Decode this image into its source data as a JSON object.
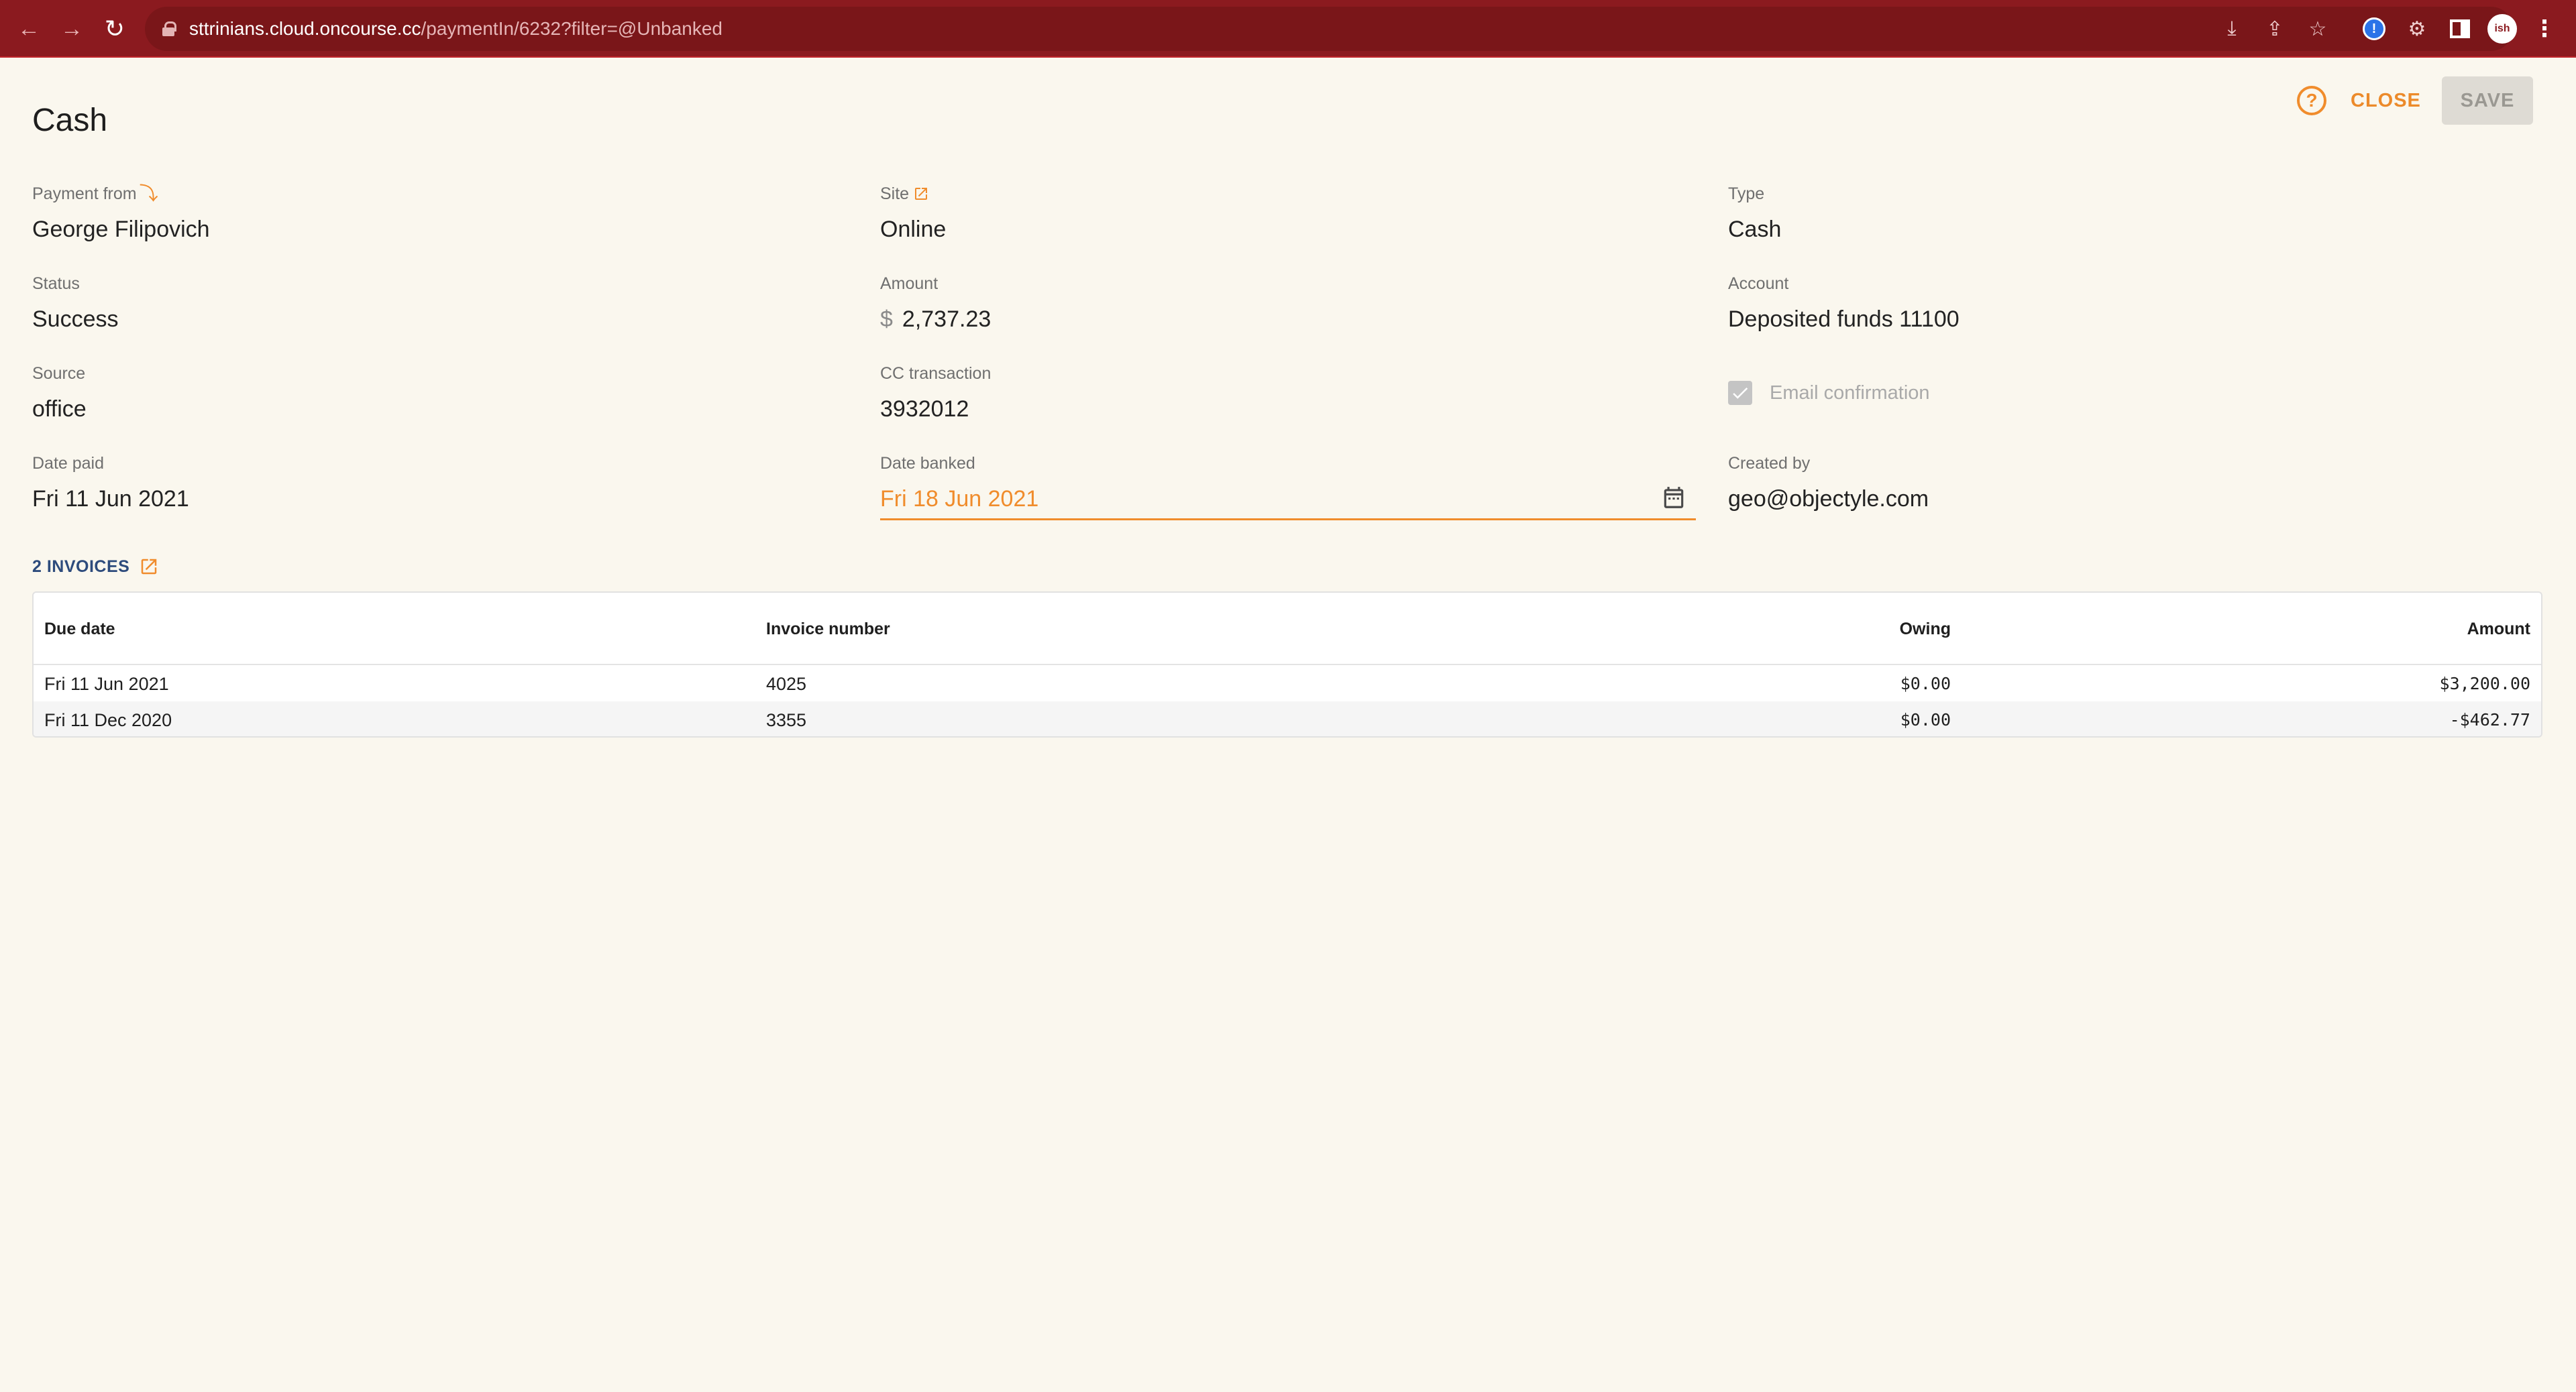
{
  "browser": {
    "url_host": "sttrinians.cloud.oncourse.cc",
    "url_path": "/paymentIn/6232?filter=@Unbanked",
    "avatar_text": "ish"
  },
  "header": {
    "title": "Cash",
    "close_label": "CLOSE",
    "save_label": "SAVE"
  },
  "fields": {
    "payment_from": {
      "label": "Payment from",
      "value": "George Filipovich"
    },
    "status": {
      "label": "Status",
      "value": "Success"
    },
    "source": {
      "label": "Source",
      "value": "office"
    },
    "date_paid": {
      "label": "Date paid",
      "value": "Fri 11 Jun 2021"
    },
    "site": {
      "label": "Site",
      "value": "Online"
    },
    "amount": {
      "label": "Amount",
      "currency": "$",
      "value": "2,737.23"
    },
    "cc_transaction": {
      "label": "CC transaction",
      "value": "3932012"
    },
    "date_banked": {
      "label": "Date banked",
      "value": "Fri 18 Jun 2021"
    },
    "type": {
      "label": "Type",
      "value": "Cash"
    },
    "account": {
      "label": "Account",
      "value": "Deposited funds 11100"
    },
    "email_confirmation": {
      "label": "Email confirmation",
      "checked": true
    },
    "created_by": {
      "label": "Created by",
      "value": "geo@objectyle.com"
    }
  },
  "invoices": {
    "heading": "2 INVOICES",
    "columns": {
      "due_date": "Due date",
      "invoice_number": "Invoice number",
      "owing": "Owing",
      "amount": "Amount"
    },
    "rows": [
      {
        "due_date": "Fri 11 Jun 2021",
        "invoice_number": "4025",
        "owing": "$0.00",
        "amount": "$3,200.00"
      },
      {
        "due_date": "Fri 11 Dec 2020",
        "invoice_number": "3355",
        "owing": "$0.00",
        "amount": "-$462.77"
      }
    ]
  },
  "colors": {
    "accent": "#f08c2c",
    "chrome": "#8b1a1f",
    "background": "#faf7ee",
    "link_blue": "#2d4b7c"
  }
}
